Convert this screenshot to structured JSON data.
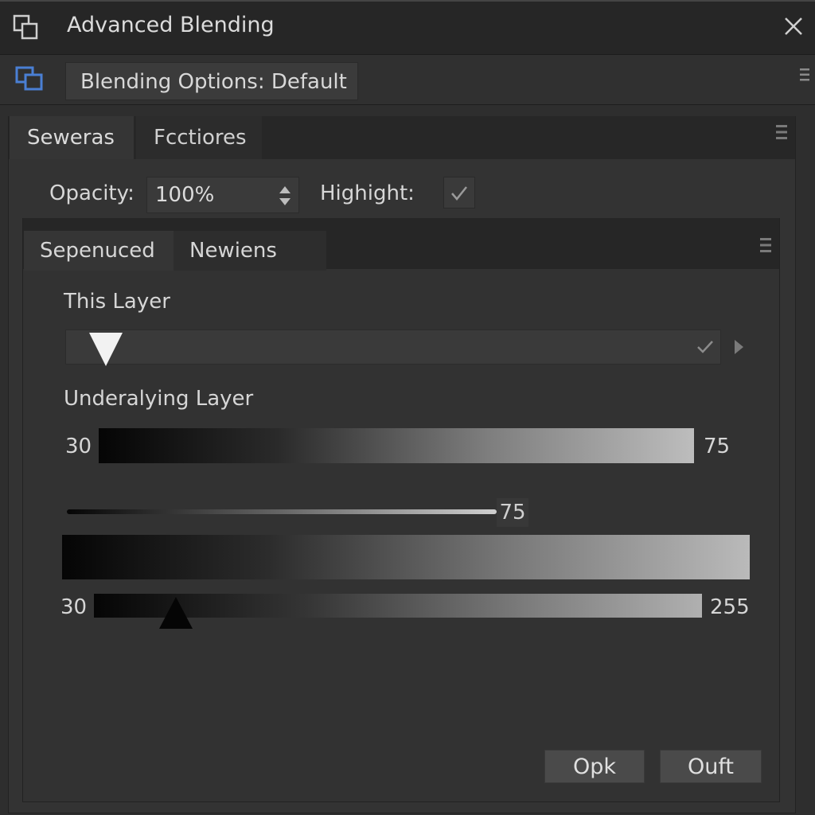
{
  "window": {
    "title": "Advanced Blending"
  },
  "options_bar": {
    "preset_label": "Blending Options: Default"
  },
  "outer_tabs": [
    {
      "label": "Seweras",
      "active": true
    },
    {
      "label": "Fcctiores",
      "active": false
    }
  ],
  "opacity": {
    "label": "Opacity:",
    "value": "100%"
  },
  "highlight": {
    "label": "Highight:",
    "checked": true
  },
  "inner_tabs": [
    {
      "label": "Sepenuced",
      "active": true
    },
    {
      "label": "Newiens",
      "active": false
    }
  ],
  "this_layer": {
    "label": "This Layer"
  },
  "underlying_layer": {
    "label": "Underalying Layer",
    "gradient_left": "30",
    "gradient_right": "75",
    "thin_slider_value": "75",
    "bottom_left": "30",
    "bottom_right": "255"
  },
  "buttons": {
    "ok": "Opk",
    "cancel": "Ouft"
  },
  "colors": {
    "background": "#2e2e2e",
    "titlebar": "#262626",
    "accent_icon": "#4a7fd4"
  }
}
